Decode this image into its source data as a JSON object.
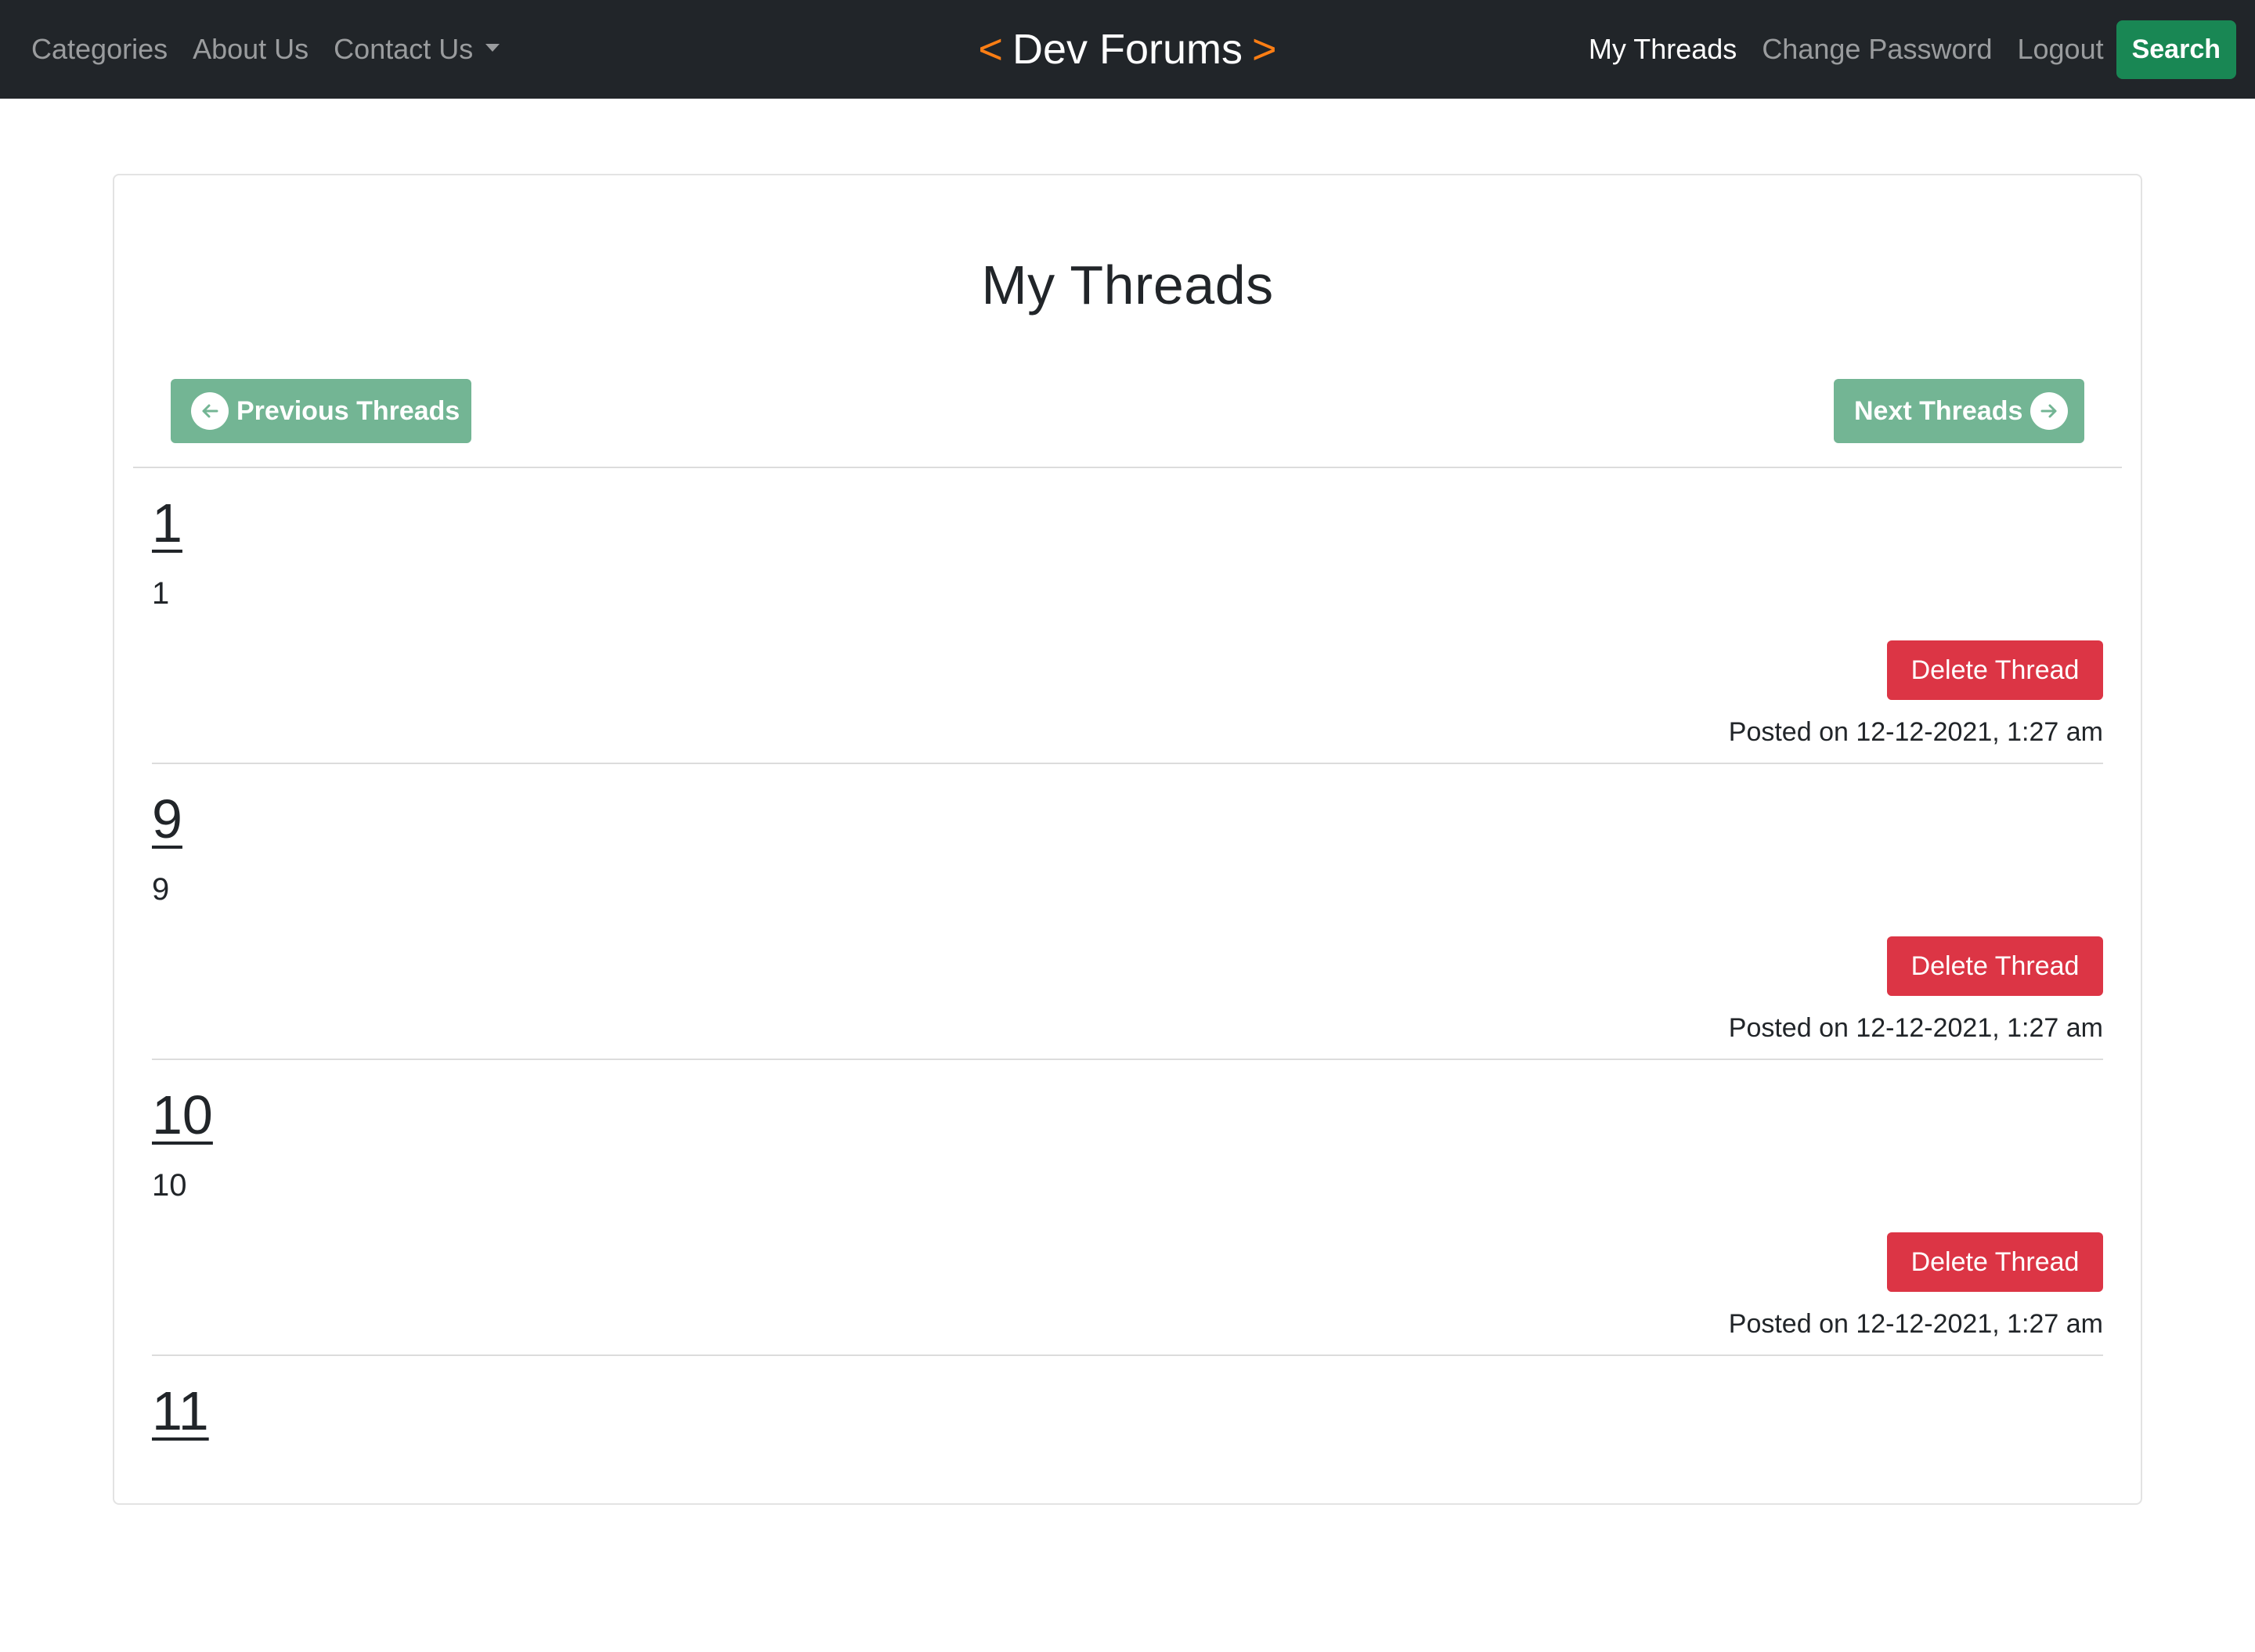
{
  "navbar": {
    "left_links": [
      {
        "label": "Categories"
      },
      {
        "label": "About Us"
      },
      {
        "label": "Contact Us"
      }
    ],
    "brand": {
      "open": "<",
      "text": "Dev Forums",
      "close": ">"
    },
    "right_links": [
      {
        "label": "My Threads",
        "active": true
      },
      {
        "label": "Change Password"
      },
      {
        "label": "Logout"
      }
    ],
    "search_label": "Search"
  },
  "page": {
    "title": "My Threads",
    "prev_label": "Previous Threads",
    "next_label": "Next Threads"
  },
  "threads": [
    {
      "title": "1",
      "body": "1",
      "delete_label": "Delete Thread",
      "posted": "Posted on 12-12-2021, 1:27 am"
    },
    {
      "title": "9",
      "body": "9",
      "delete_label": "Delete Thread",
      "posted": "Posted on 12-12-2021, 1:27 am"
    },
    {
      "title": "10",
      "body": "10",
      "delete_label": "Delete Thread",
      "posted": "Posted on 12-12-2021, 1:27 am"
    },
    {
      "title": "11",
      "body": "",
      "delete_label": "",
      "posted": ""
    }
  ],
  "colors": {
    "navbar_bg": "#212529",
    "brand_accent": "#fd7e14",
    "search_button": "#198754",
    "pager_button": "#73b594",
    "delete_button": "#dc3545"
  },
  "icons": {
    "prev": "arrow-left-circle-icon",
    "next": "arrow-right-circle-icon",
    "dropdown": "caret-down-icon"
  }
}
